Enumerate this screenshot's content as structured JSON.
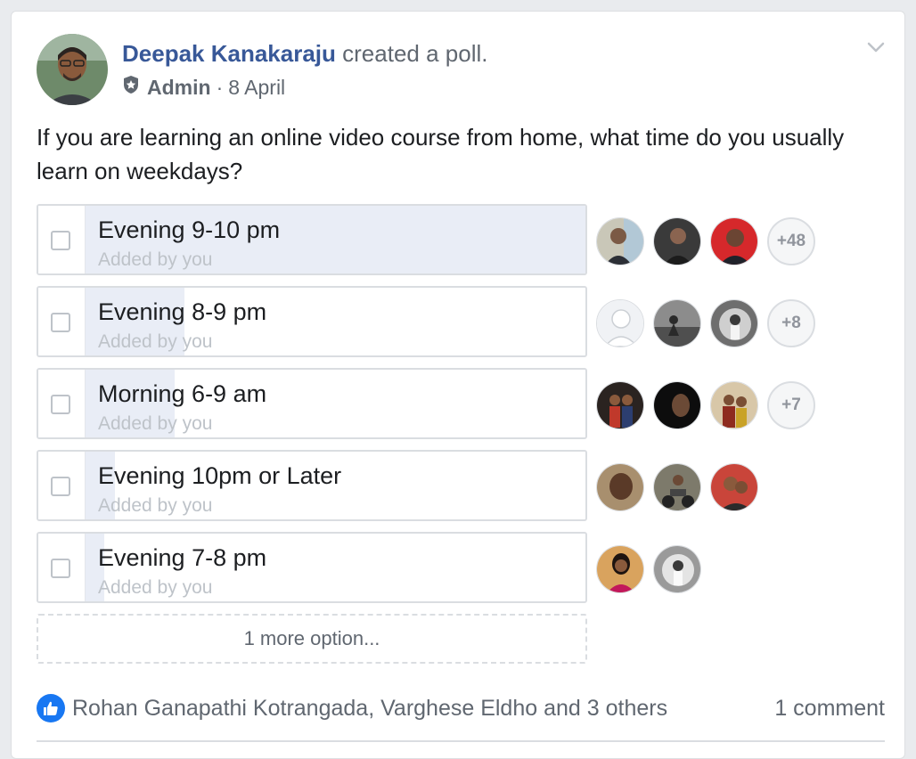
{
  "post": {
    "author": "Deepak Kanakaraju",
    "action": "created a poll.",
    "role": "Admin",
    "separator": "·",
    "date": "8 April",
    "question": "If you are learning an online video course from home, what time do you usually learn on weekdays?"
  },
  "poll": {
    "options": [
      {
        "label": "Evening 9-10 pm",
        "added_by": "Added by you",
        "vote_share": 1.0,
        "more_voters": "+48"
      },
      {
        "label": "Evening 8-9 pm",
        "added_by": "Added by you",
        "vote_share": 0.2,
        "more_voters": "+8"
      },
      {
        "label": "Morning 6-9 am",
        "added_by": "Added by you",
        "vote_share": 0.18,
        "more_voters": "+7"
      },
      {
        "label": "Evening 10pm or Later",
        "added_by": "Added by you",
        "vote_share": 0.06,
        "more_voters": ""
      },
      {
        "label": "Evening 7-8 pm",
        "added_by": "Added by you",
        "vote_share": 0.04,
        "more_voters": ""
      }
    ],
    "more_options_label": "1 more option..."
  },
  "footer": {
    "reactors": "Rohan Ganapathi Kotrangada, Varghese Eldho and 3 others",
    "comments": "1 comment"
  },
  "colors": {
    "link_blue": "#385898",
    "fill": "#e9edf6",
    "like_blue": "#1877f2"
  }
}
